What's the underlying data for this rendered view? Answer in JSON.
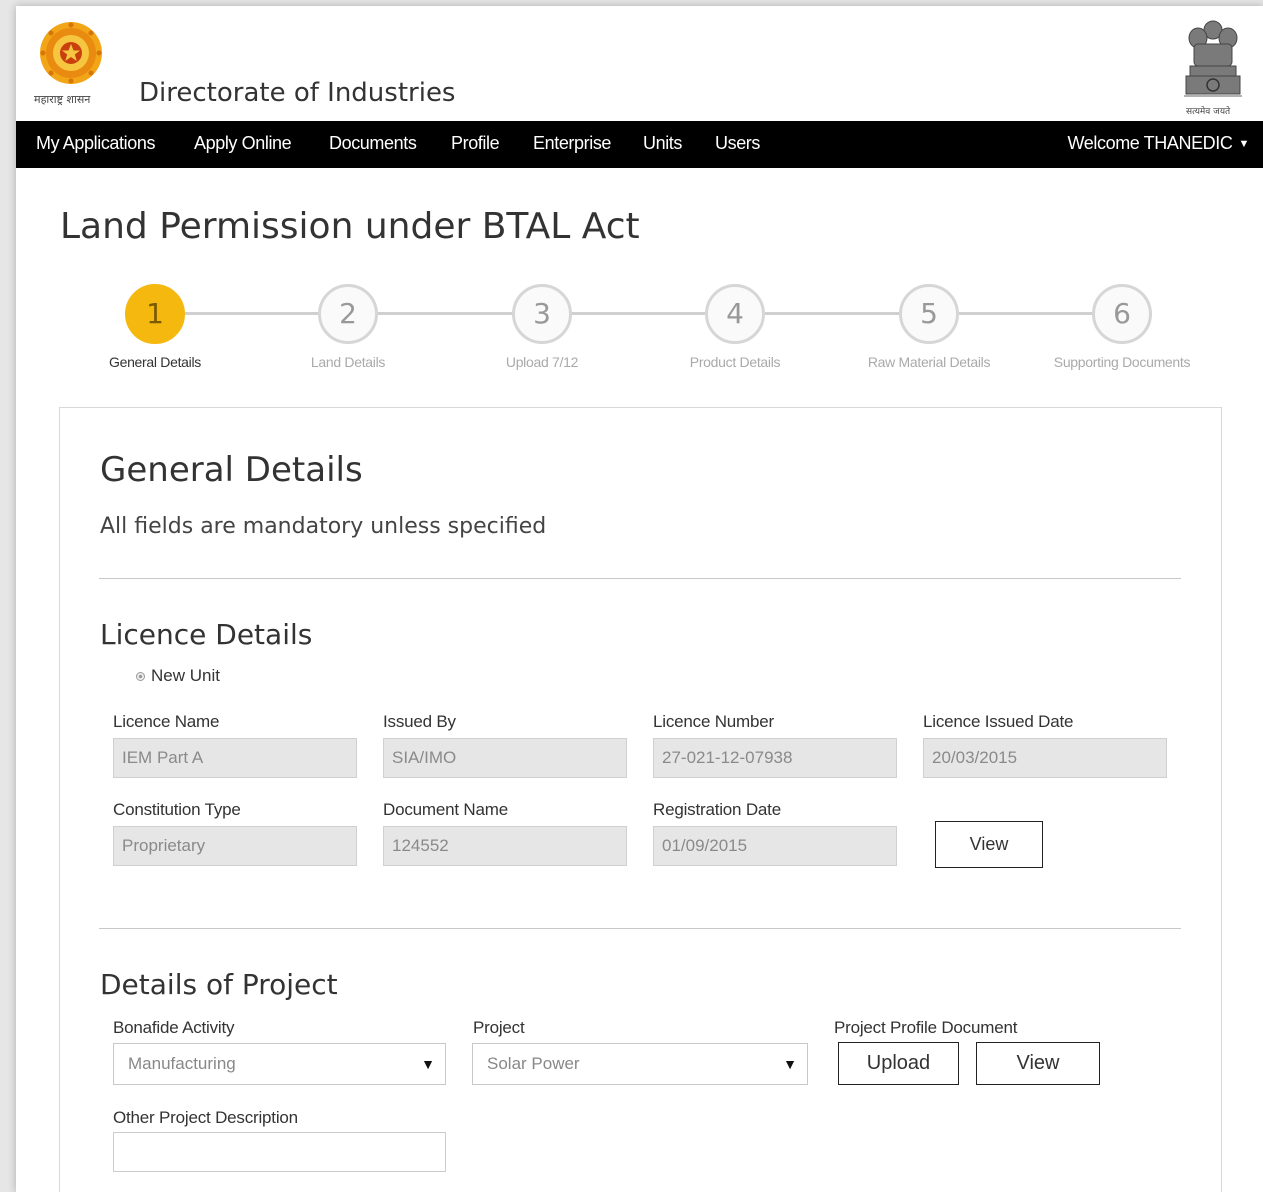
{
  "header": {
    "emblem_left_caption": "महाराष्ट्र शासन",
    "site_title": "Directorate of Industries",
    "emblem_right_caption": "सत्यमेव जयते"
  },
  "nav": {
    "items": [
      "My Applications",
      "Apply Online",
      "Documents",
      "Profile",
      "Enterprise",
      "Units",
      "Users"
    ],
    "welcome": "Welcome THANEDIC"
  },
  "page_title": "Land Permission under BTAL Act",
  "stepper": {
    "active_step": 1,
    "steps": [
      {
        "number": "1",
        "label": "General Details"
      },
      {
        "number": "2",
        "label": "Land Details"
      },
      {
        "number": "3",
        "label": "Upload 7/12"
      },
      {
        "number": "4",
        "label": "Product Details"
      },
      {
        "number": "5",
        "label": "Raw Material Details"
      },
      {
        "number": "6",
        "label": "Supporting Documents"
      }
    ],
    "active_color": "#f5b80f"
  },
  "form": {
    "title": "General Details",
    "note": "All fields are mandatory unless specified",
    "licence": {
      "heading": "Licence Details",
      "radio_label": "New Unit",
      "fields": {
        "licence_name": {
          "label": "Licence Name",
          "value": "IEM Part A"
        },
        "issued_by": {
          "label": "Issued By",
          "value": "SIA/IMO"
        },
        "licence_number": {
          "label": "Licence Number",
          "value": "27-021-12-07938"
        },
        "licence_issued_date": {
          "label": "Licence Issued Date",
          "value": "20/03/2015"
        },
        "constitution_type": {
          "label": "Constitution Type",
          "value": "Proprietary"
        },
        "document_name": {
          "label": "Document Name",
          "value": "124552"
        },
        "registration_date": {
          "label": "Registration Date",
          "value": "01/09/2015"
        }
      },
      "view_button": "View"
    },
    "project": {
      "heading": "Details of Project",
      "bonafide_activity": {
        "label": "Bonafide Activity",
        "value": "Manufacturing"
      },
      "project": {
        "label": "Project",
        "value": "Solar Power"
      },
      "profile_document": {
        "label": "Project Profile Document",
        "upload_button": "Upload",
        "view_button": "View"
      },
      "other_description": {
        "label": "Other Project Description",
        "value": ""
      }
    }
  }
}
